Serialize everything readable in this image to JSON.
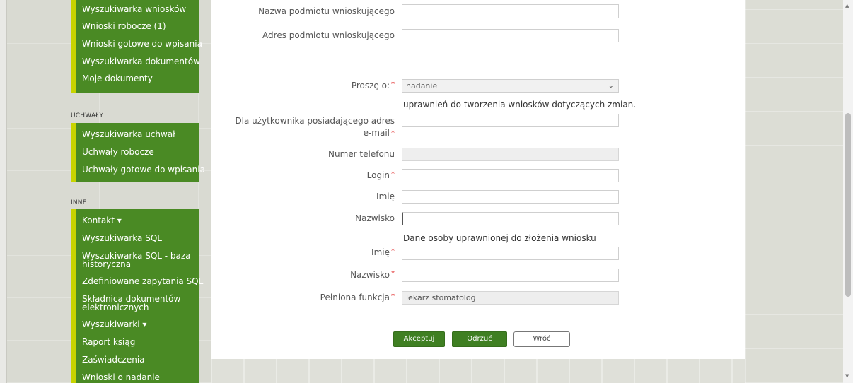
{
  "sidebar": {
    "block1": [
      "Wyszukiwarka wniosków",
      "Wnioski robocze (1)",
      "Wnioski gotowe do wpisania",
      "Wyszukiwarka dokumentów",
      "Moje dokumenty"
    ],
    "section_uchwaly": "UCHWAŁY",
    "block2": [
      "Wyszukiwarka uchwał",
      "Uchwały robocze",
      "Uchwały gotowe do wpisania"
    ],
    "section_inne": "INNE",
    "block3": [
      "Kontakt ▾",
      "Wyszukiwarka SQL",
      "Wyszukiwarka SQL - baza historyczna",
      "Zdefiniowane zapytania SQL",
      "Składnica dokumentów elektronicznych",
      "Wyszukiwarki ▾",
      "Raport ksiąg",
      "Zaświadczenia",
      "Wnioski o nadanie"
    ]
  },
  "form": {
    "nazwa_label": "Nazwa podmiotu wnioskującego",
    "adres_label": "Adres podmiotu wnioskującego",
    "prosze_label": "Proszę o:",
    "prosze_value": "nadanie",
    "prosze_note": "uprawnień do tworzenia wniosków dotyczących zmian.",
    "email_label_1": "Dla użytkownika posiadającego adres",
    "email_label_2": "e-mail",
    "telefon_label": "Numer telefonu",
    "login_label": "Login",
    "imie_label": "Imię",
    "nazwisko_label": "Nazwisko",
    "osoba_heading": "Dane osoby uprawnionej do złożenia wniosku",
    "osoba_imie_label": "Imię",
    "osoba_nazwisko_label": "Nazwisko",
    "funkcja_label": "Pełniona funkcja",
    "funkcja_value": "lekarz stomatolog",
    "required_mark": "*"
  },
  "buttons": {
    "akceptuj": "Akceptuj",
    "odrzuc": "Odrzuć",
    "wroc": "Wróć"
  },
  "colors": {
    "menu_green": "#4a8a24",
    "menu_accent": "#c8d400",
    "button_green": "#3f7f22",
    "required_red": "#dd1111"
  }
}
